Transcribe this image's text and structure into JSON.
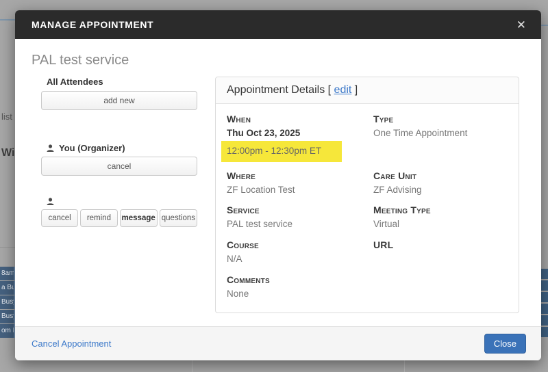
{
  "backdrop": {
    "left_text_list": "list",
    "left_text_wi": "Wi",
    "left_busy_rows": [
      "8am",
      "a Bus",
      "Busy",
      "Busy",
      "om B"
    ]
  },
  "modal": {
    "title": "MANAGE APPOINTMENT",
    "close_icon": "✕",
    "service_title": "PAL test service",
    "attendees": {
      "heading": "All Attendees",
      "add_new_label": "add new",
      "organizer": {
        "name": "You (Organizer)",
        "cancel_label": "cancel"
      },
      "attendee_actions": [
        "cancel",
        "remind",
        "message",
        "questions"
      ]
    },
    "details": {
      "heading": "Appointment Details",
      "bracket_open": "[",
      "edit_label": "edit",
      "bracket_close": "]",
      "fields": {
        "when": {
          "label": "When",
          "date": "Thu Oct 23, 2025",
          "time": "12:00pm - 12:30pm ET"
        },
        "type": {
          "label": "Type",
          "value": "One Time Appointment"
        },
        "where": {
          "label": "Where",
          "value": "ZF Location Test"
        },
        "care_unit": {
          "label": "Care Unit",
          "value": "ZF Advising"
        },
        "service": {
          "label": "Service",
          "value": "PAL test service"
        },
        "meeting_type": {
          "label": "Meeting Type",
          "value": "Virtual"
        },
        "course": {
          "label": "Course",
          "value": "N/A"
        },
        "url": {
          "label": "URL",
          "value": ""
        },
        "comments": {
          "label": "Comments",
          "value": "None"
        }
      }
    },
    "footer": {
      "cancel_appointment_label": "Cancel Appointment",
      "close_label": "Close"
    }
  },
  "colors": {
    "accent_blue": "#3b78c9",
    "close_button_blue": "#3a72b8",
    "highlight_yellow": "#f6e73a",
    "header_dark": "#2b2b2b",
    "busy_slot_blue": "#45617f",
    "backdrop_gray": "#a7a7a7"
  }
}
